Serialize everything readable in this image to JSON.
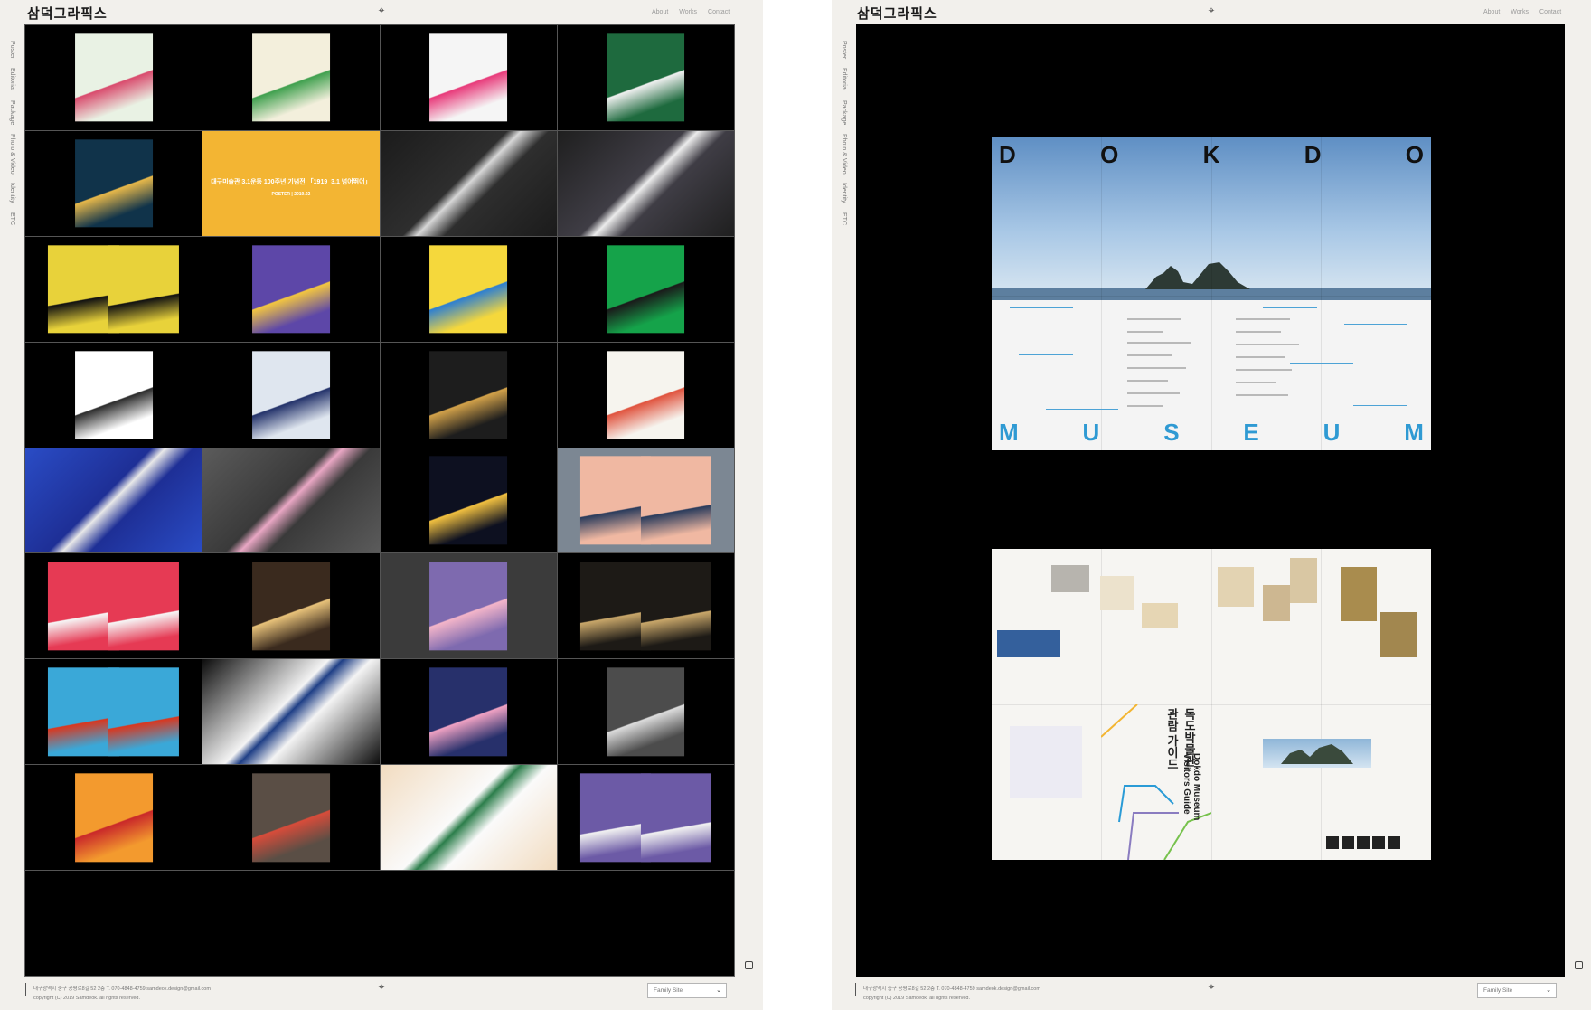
{
  "site": {
    "logo": "삼덕그라픽스",
    "nav": [
      "About",
      "Works",
      "Contact"
    ],
    "sidebar": [
      "Poster",
      "Editorial",
      "Package",
      "Photo & Video",
      "Identity",
      "ETC"
    ],
    "footer": {
      "address": "대구광역시 중구 공평로8길 52 2층 T. 070-4848-4759 samdeok.design@gmail.com",
      "copyright": "copyright (C) 2019 Samdeok. all rights reserved."
    },
    "family_site": "Family Site"
  },
  "gallery": {
    "tile_with_text": {
      "title": "대구미술관 3.1운동 100주년 기념전 「1919_3.1 넘어뛰어」",
      "meta": "POSTER | 2019.02"
    },
    "tiles": [
      {
        "kind": "poster",
        "bg": "#000000",
        "color": "#e9f2e4",
        "accent": "#d94b6d"
      },
      {
        "kind": "poster",
        "bg": "#000000",
        "color": "#f3efdc",
        "accent": "#3fa04e"
      },
      {
        "kind": "poster",
        "bg": "#000000",
        "color": "#f5f5f5",
        "accent": "#e83a7a"
      },
      {
        "kind": "poster",
        "bg": "#000000",
        "color": "#1e6a3e",
        "accent": "#f0f0f0"
      },
      {
        "kind": "poster",
        "bg": "#000000",
        "color": "#10334a",
        "accent": "#e7b84a"
      },
      {
        "kind": "text",
        "bg": "#f3b533",
        "color": "#f3b533",
        "accent": "#ffffff"
      },
      {
        "kind": "photo",
        "bg": "#1b1b1b",
        "color": "#2e2e2e",
        "accent": "#d7d7d7"
      },
      {
        "kind": "photo",
        "bg": "#1f1f1f",
        "color": "#3f3d45",
        "accent": "#ececec"
      },
      {
        "kind": "double",
        "bg": "#000000",
        "color": "#e8d23a",
        "accent": "#111111"
      },
      {
        "kind": "poster",
        "bg": "#000000",
        "color": "#5d47a8",
        "accent": "#f3c640"
      },
      {
        "kind": "poster",
        "bg": "#000000",
        "color": "#f5d83c",
        "accent": "#2d7fd1"
      },
      {
        "kind": "poster",
        "bg": "#000000",
        "color": "#15a34a",
        "accent": "#1a1a1a"
      },
      {
        "kind": "poster",
        "bg": "#000000",
        "color": "#ffffff",
        "accent": "#2c2c2c"
      },
      {
        "kind": "poster",
        "bg": "#000000",
        "color": "#dfe6ef",
        "accent": "#23326a"
      },
      {
        "kind": "poster",
        "bg": "#000000",
        "color": "#1d1d1d",
        "accent": "#d3a24a"
      },
      {
        "kind": "poster",
        "bg": "#000000",
        "color": "#f6f4ee",
        "accent": "#e0533e"
      },
      {
        "kind": "photo",
        "bg": "#2a4cc5",
        "color": "#1e2f96",
        "accent": "#e8e8e8"
      },
      {
        "kind": "photo",
        "bg": "#5b5b5b",
        "color": "#3a3a3a",
        "accent": "#e9a7c4"
      },
      {
        "kind": "poster",
        "bg": "#000000",
        "color": "#0d1020",
        "accent": "#f1c040"
      },
      {
        "kind": "double",
        "bg": "#7c8793",
        "color": "#f0b8a2",
        "accent": "#2a3b5c"
      },
      {
        "kind": "double",
        "bg": "#000000",
        "color": "#e63a54",
        "accent": "#f6f6f6"
      },
      {
        "kind": "poster",
        "bg": "#000000",
        "color": "#3a2a1e",
        "accent": "#e8c27a"
      },
      {
        "kind": "poster",
        "bg": "#3b3b3b",
        "color": "#7e6aaf",
        "accent": "#f4b5c9"
      },
      {
        "kind": "double",
        "bg": "#000000",
        "color": "#1d1a16",
        "accent": "#c9a76a"
      },
      {
        "kind": "double",
        "bg": "#000000",
        "color": "#3aa8d8",
        "accent": "#d9371f"
      },
      {
        "kind": "photo",
        "bg": "#0c0c0c",
        "color": "#f4f4f4",
        "accent": "#1f3f86"
      },
      {
        "kind": "poster",
        "bg": "#000000",
        "color": "#27306b",
        "accent": "#f0a2c3"
      },
      {
        "kind": "poster",
        "bg": "#000000",
        "color": "#4c4c4c",
        "accent": "#dcdcdc"
      },
      {
        "kind": "poster",
        "bg": "#000000",
        "color": "#f39a2e",
        "accent": "#c9282a"
      },
      {
        "kind": "poster",
        "bg": "#000000",
        "color": "#5a4e45",
        "accent": "#d84c3a"
      },
      {
        "kind": "photo",
        "bg": "#f2dcc0",
        "color": "#fafafa",
        "accent": "#2c7e4b"
      },
      {
        "kind": "double",
        "bg": "#000000",
        "color": "#6c5aa6",
        "accent": "#f1f1f1"
      }
    ]
  },
  "detail": {
    "top_sheet": {
      "header_letters": [
        "D",
        "O",
        "K",
        "D",
        "O"
      ],
      "footer_letters": [
        "M",
        "U",
        "S",
        "E",
        "U",
        "M"
      ],
      "footer_color": "#2f9ad3"
    },
    "bottom_sheet": {
      "guide_title_ko": "독도박물관 관람 가이드",
      "guide_title_en": "Dokdo Museum Visitors Guide",
      "line_colors": [
        "#f3b532",
        "#2a9bd6",
        "#8a7cc0",
        "#77c24d"
      ]
    }
  }
}
